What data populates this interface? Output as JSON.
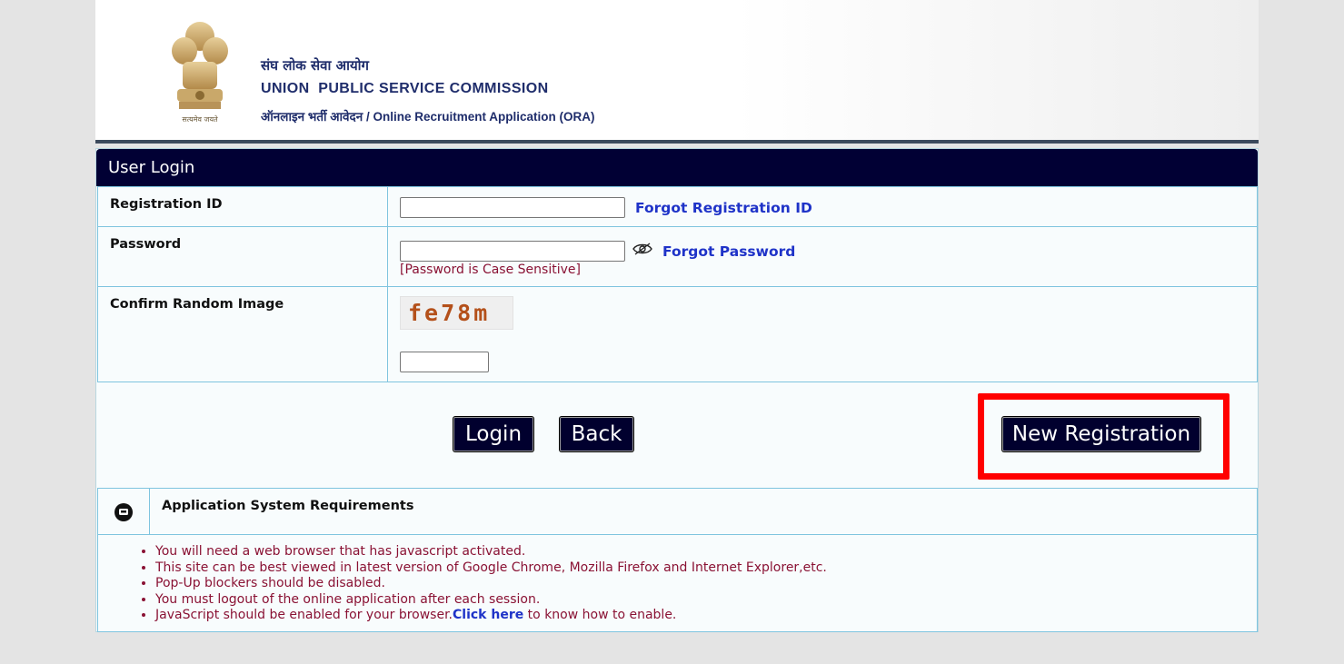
{
  "header": {
    "hindi_title": "संघ लोक सेवा आयोग",
    "title": "UNION  PUBLIC SERVICE COMMISSION",
    "subtitle": "ऑनलाइन भर्ती आवेदन / Online Recruitment Application (ORA)",
    "emblem_motto": "सत्यमेव जयते"
  },
  "login": {
    "panel_title": "User Login",
    "registration_label": "Registration ID",
    "registration_value": "",
    "forgot_registration": "Forgot Registration ID",
    "password_label": "Password",
    "password_value": "",
    "forgot_password": "Forgot Password",
    "password_note": "[Password is Case Sensitive]",
    "captcha_label": "Confirm Random Image",
    "captcha_text": "fe78m",
    "captcha_value": "",
    "login_button": "Login",
    "back_button": "Back",
    "new_registration_button": "New Registration",
    "highlight_color": "#ff0000"
  },
  "requirements": {
    "title": "Application System Requirements",
    "items": [
      "You will need a web browser that has javascript activated.",
      "This site can be best viewed in latest version of Google Chrome, Mozilla Firefox and Internet Explorer,etc.",
      "Pop-Up blockers should be disabled.",
      "You must logout of the online application after each session."
    ],
    "last_item_prefix": "JavaScript should be enabled for your browser.",
    "last_item_link": "Click here",
    "last_item_suffix": " to know how to enable."
  },
  "icons": {
    "emblem": "national-emblem-icon",
    "password_toggle": "eye-slash-icon",
    "collapse": "collapse-circle-icon"
  },
  "colors": {
    "panel_header": "#010034",
    "link": "#1f33c8",
    "note": "#8a1234",
    "border": "#7fc4df"
  }
}
